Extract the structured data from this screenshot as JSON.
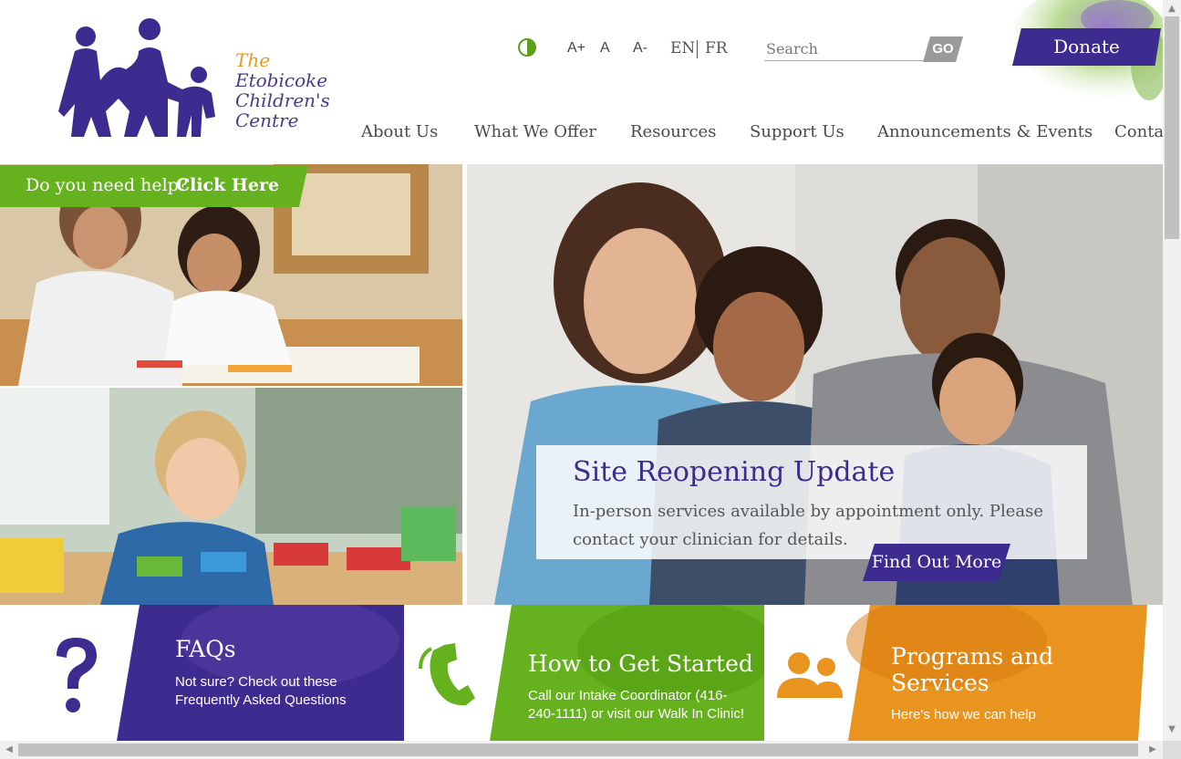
{
  "header": {
    "logo_lines": [
      "The",
      "Etobicoke",
      "Children's",
      "Centre"
    ],
    "font_controls": [
      "A+",
      "A",
      "A-"
    ],
    "languages": [
      "EN",
      "FR"
    ],
    "search_placeholder": "Search",
    "go_label": "GO",
    "donate_label": "Donate"
  },
  "nav": {
    "items": [
      "About Us",
      "What We Offer",
      "Resources",
      "Support Us",
      "Announcements & Events",
      "Contac"
    ]
  },
  "help": {
    "prefix": "Do you need help?",
    "link": "Click Here"
  },
  "hero": {
    "title": "Site Reopening Update",
    "line1": "In-person services available by appointment only.  Please",
    "line2": "contact your clinician for details.",
    "button": "Find Out More"
  },
  "cards": [
    {
      "title": "FAQs",
      "lines": [
        "Not sure? Check out these",
        "Frequently Asked Questions"
      ],
      "color": "#3d2b8f"
    },
    {
      "title": "How to Get Started",
      "lines": [
        "Call our Intake Coordinator (416-",
        "240-1111) or visit our Walk In Clinic!"
      ],
      "color": "#66b21e"
    },
    {
      "title": "Programs and",
      "title2": "Services",
      "lines": [
        "Here's how we can help"
      ],
      "color": "#e8941e"
    }
  ],
  "colors": {
    "purple": "#3d2b8f",
    "green": "#66b21e",
    "orange": "#e8941e"
  }
}
